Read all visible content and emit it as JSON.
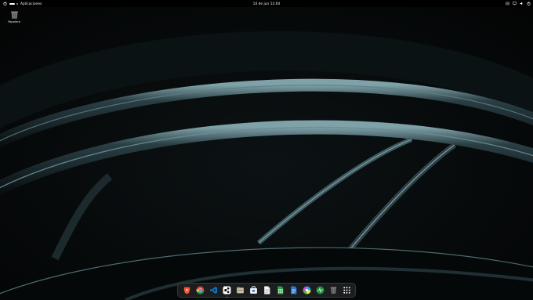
{
  "topbar": {
    "activities_label": "Aplicaciones",
    "clock": "14 de jun  12:04"
  },
  "desktop": {
    "trash_label": "Papelera"
  },
  "dock": {
    "items": [
      {
        "name": "brave-icon"
      },
      {
        "name": "chrome-icon"
      },
      {
        "name": "vscode-icon"
      },
      {
        "name": "davinci-resolve-icon",
        "running": true
      },
      {
        "name": "files-icon"
      },
      {
        "name": "software-store-icon"
      },
      {
        "name": "text-editor-icon"
      },
      {
        "name": "spreadsheet-icon"
      },
      {
        "name": "writer-icon"
      },
      {
        "name": "color-picker-icon"
      },
      {
        "name": "system-monitor-icon"
      },
      {
        "name": "trash-dock-icon"
      },
      {
        "name": "app-grid-icon"
      }
    ]
  },
  "colors": {
    "wallpaper_base": "#040607",
    "ribbon_highlight": "#5e8088",
    "topbar": "#000000"
  }
}
